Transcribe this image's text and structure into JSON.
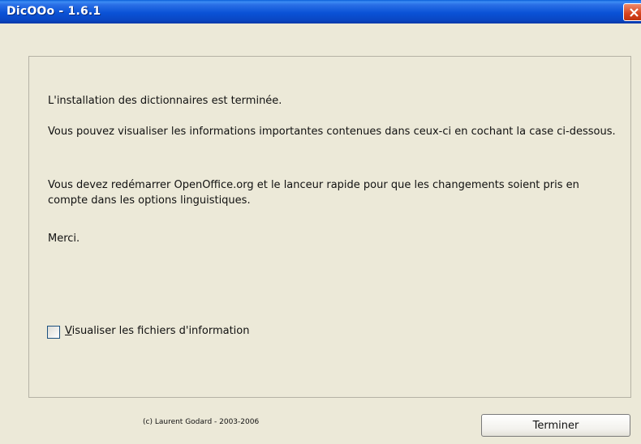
{
  "window": {
    "title": "DicOOo - 1.6.1",
    "close_icon": "close-icon"
  },
  "content": {
    "line1": "L'installation des dictionnaires est terminée.",
    "line2": "Vous pouvez visualiser les informations importantes contenues dans ceux-ci en cochant la case ci-dessous.",
    "line3": "Vous devez redémarrer OpenOffice.org et le lanceur rapide pour que les changements soient pris en compte dans les options linguistiques.",
    "line4": "Merci."
  },
  "checkbox": {
    "label_mnemonic": "V",
    "label_rest": "isualiser les fichiers d'information",
    "checked": false
  },
  "footer": {
    "copyright": "(c) Laurent Godard - 2003-2006",
    "finish_button": "Terminer"
  },
  "colors": {
    "titlebar": "#0a52d6",
    "window_bg": "#ece9d8",
    "close_button": "#d5431e"
  }
}
